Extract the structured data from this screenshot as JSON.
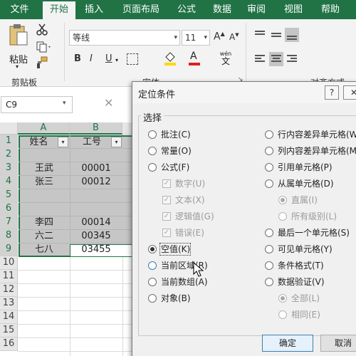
{
  "ribbon_tabs": [
    "文件",
    "开始",
    "插入",
    "页面布局",
    "公式",
    "数据",
    "审阅",
    "视图",
    "帮助"
  ],
  "ribbon": {
    "paste_label": "粘贴",
    "clipboard_group": "剪贴板",
    "font_name": "等线",
    "font_size": "11",
    "font_group": "字体",
    "alignment_group": "对齐方式",
    "increase_font": "A",
    "decrease_font": "A",
    "bold": "B",
    "italic": "I",
    "underline": "U",
    "font_color_letter": "A",
    "wen_label": "wén",
    "wen_char": "文",
    "font_color_accent": "#e02020",
    "fill_color_accent": "#ffd800"
  },
  "formula_bar": {
    "name_box": "C9",
    "cancel_symbol": "✕"
  },
  "grid": {
    "columns": [
      "A",
      "B"
    ],
    "rows": [
      "1",
      "2",
      "3",
      "4",
      "5",
      "6",
      "7",
      "8",
      "9",
      "10",
      "11",
      "12",
      "13",
      "14",
      "15",
      "16"
    ],
    "headers": [
      "姓名",
      "工号"
    ],
    "data": [
      [
        "",
        ""
      ],
      [
        "王武",
        "00001"
      ],
      [
        "张三",
        "00012"
      ],
      [
        "",
        ""
      ],
      [
        "",
        ""
      ],
      [
        "李四",
        "00014"
      ],
      [
        "六二",
        "00345"
      ],
      [
        "七八",
        "03455"
      ]
    ],
    "accent_color": "#217346"
  },
  "dialog": {
    "title": "定位条件",
    "help_symbol": "?",
    "close_symbol": "✕",
    "group_label": "选择",
    "left_options": [
      {
        "label": "批注(C)",
        "selected": false,
        "disabled": false,
        "type": "radio"
      },
      {
        "label": "常量(O)",
        "selected": false,
        "disabled": false,
        "type": "radio"
      },
      {
        "label": "公式(F)",
        "selected": false,
        "disabled": false,
        "type": "radio"
      },
      {
        "label": "数字(U)",
        "selected": true,
        "disabled": true,
        "type": "check"
      },
      {
        "label": "文本(X)",
        "selected": true,
        "disabled": true,
        "type": "check"
      },
      {
        "label": "逻辑值(G)",
        "selected": true,
        "disabled": true,
        "type": "check"
      },
      {
        "label": "错误(E)",
        "selected": true,
        "disabled": true,
        "type": "check"
      },
      {
        "label": "空值(K)",
        "selected": true,
        "disabled": false,
        "type": "radio"
      },
      {
        "label": "当前区域(R)",
        "selected": false,
        "disabled": false,
        "type": "radio"
      },
      {
        "label": "当前数组(A)",
        "selected": false,
        "disabled": false,
        "type": "radio"
      },
      {
        "label": "对象(B)",
        "selected": false,
        "disabled": false,
        "type": "radio"
      }
    ],
    "right_options": [
      {
        "label": "行内容差异单元格(W)",
        "selected": false,
        "disabled": false
      },
      {
        "label": "列内容差异单元格(M)",
        "selected": false,
        "disabled": false
      },
      {
        "label": "引用单元格(P)",
        "selected": false,
        "disabled": false
      },
      {
        "label": "从属单元格(D)",
        "selected": false,
        "disabled": false
      },
      {
        "label": "直属(I)",
        "selected": true,
        "disabled": true
      },
      {
        "label": "所有级别(L)",
        "selected": false,
        "disabled": true
      },
      {
        "label": "最后一个单元格(S)",
        "selected": false,
        "disabled": false
      },
      {
        "label": "可见单元格(Y)",
        "selected": false,
        "disabled": false
      },
      {
        "label": "条件格式(T)",
        "selected": false,
        "disabled": false
      },
      {
        "label": "数据验证(V)",
        "selected": false,
        "disabled": false
      },
      {
        "label": "全部(L)",
        "selected": true,
        "disabled": true
      },
      {
        "label": "相同(E)",
        "selected": false,
        "disabled": true
      }
    ],
    "ok_label": "确定",
    "cancel_label": "取消"
  }
}
